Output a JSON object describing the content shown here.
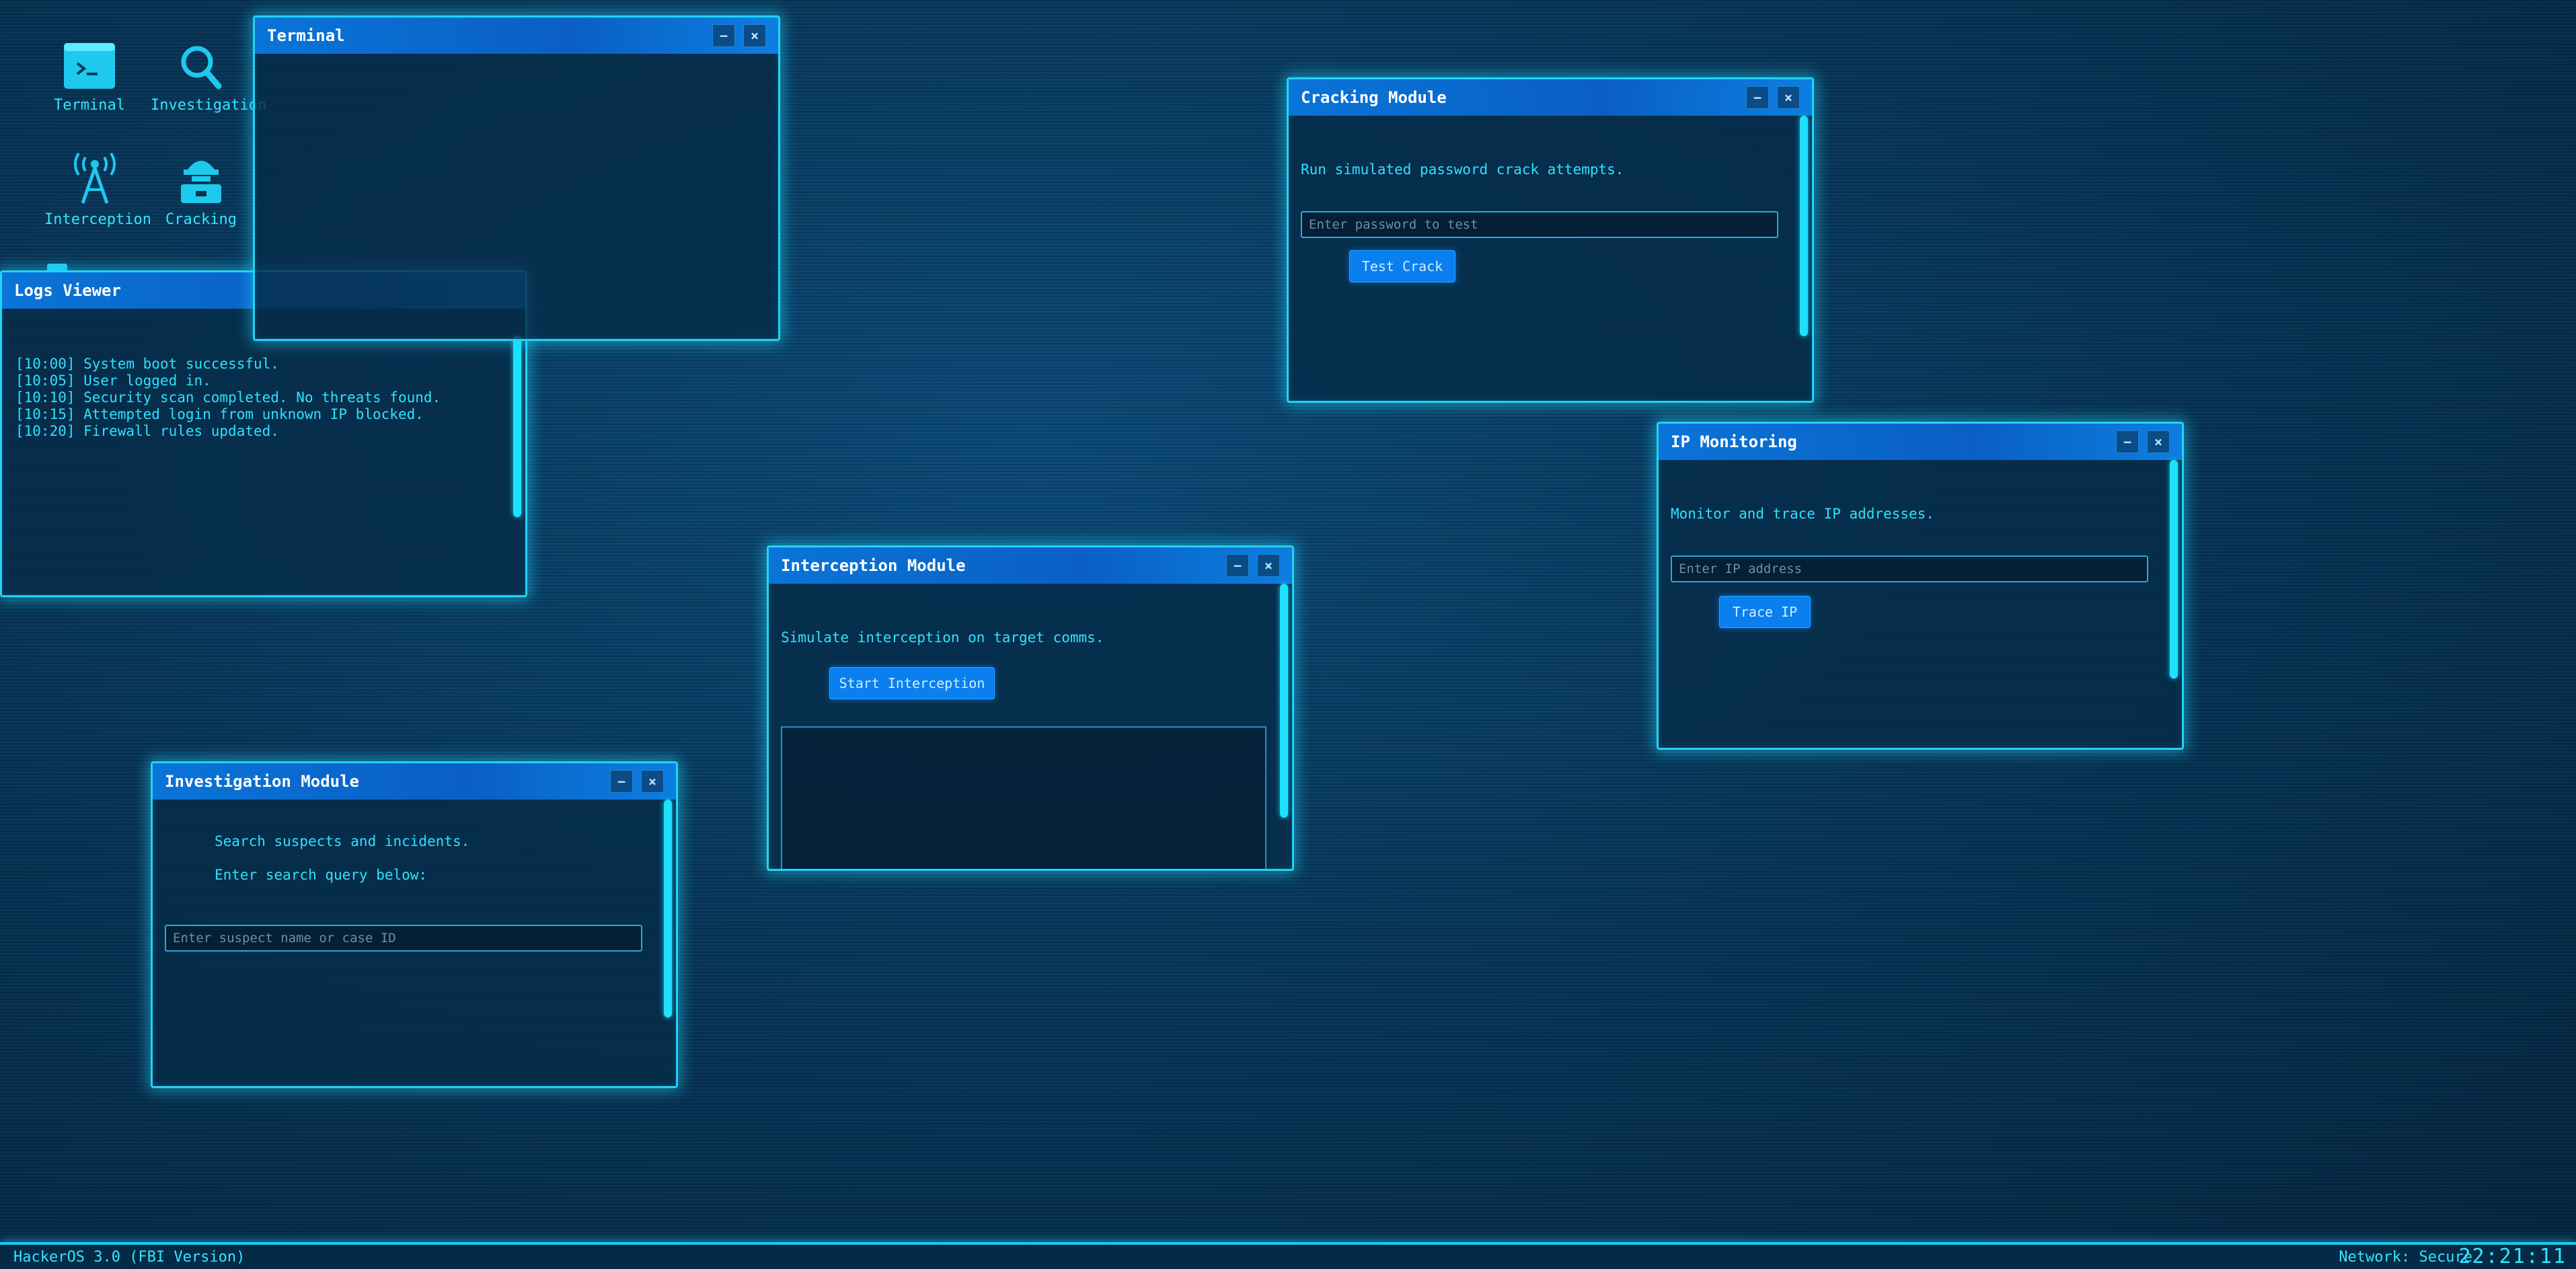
{
  "desktop": {
    "icons": [
      {
        "label": "Terminal",
        "icon": "terminal-icon"
      },
      {
        "label": "Investigation",
        "icon": "search-icon"
      },
      {
        "label": "Interception",
        "icon": "antenna-icon"
      },
      {
        "label": "Cracking",
        "icon": "hacker-icon"
      }
    ]
  },
  "windows": {
    "terminal": {
      "title": "Terminal"
    },
    "logs": {
      "title": "Logs Viewer",
      "lines": [
        "[10:00] System boot successful.",
        "[10:05] User logged in.",
        "[10:10] Security scan completed. No threats found.",
        "[10:15] Attempted login from unknown IP blocked.",
        "[10:20] Firewall rules updated."
      ]
    },
    "cracking": {
      "title": "Cracking Module",
      "description": "Run simulated password crack attempts.",
      "input_placeholder": "Enter password to test",
      "button_label": "Test Crack"
    },
    "ip": {
      "title": "IP Monitoring",
      "description": "Monitor and trace IP addresses.",
      "input_placeholder": "Enter IP address",
      "button_label": "Trace IP"
    },
    "interception": {
      "title": "Interception Module",
      "description": "Simulate interception on target comms.",
      "button_label": "Start Interception"
    },
    "investigation": {
      "title": "Investigation Module",
      "line1": "Search suspects and incidents.",
      "line2": "Enter search query below:",
      "input_placeholder": "Enter suspect name or case ID"
    },
    "controls": {
      "minimize": "−",
      "close": "×"
    }
  },
  "taskbar": {
    "os_name": "HackerOS 3.0 (FBI Version)",
    "network_status": "Network: Secure",
    "clock": "22:21:11"
  },
  "colors": {
    "accent": "#21d4f5",
    "title_bar": "#0a74d8",
    "text": "#2ee2ff",
    "button": "#0a7ff0"
  }
}
